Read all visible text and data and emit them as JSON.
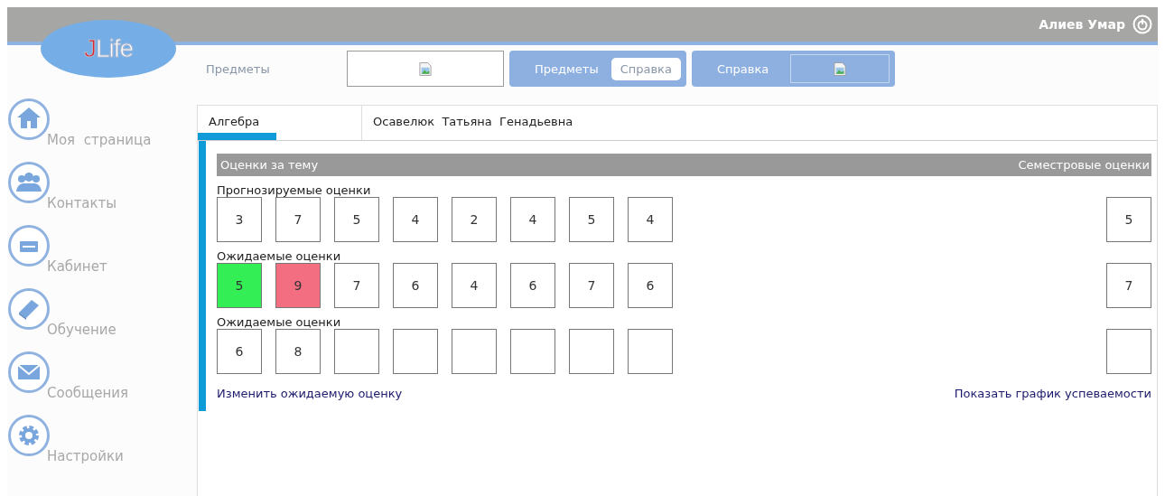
{
  "header": {
    "logo": "JLife",
    "user": "Алиев Умар"
  },
  "nav": [
    {
      "kind": "link",
      "label": "Предметы"
    },
    {
      "kind": "image-box"
    },
    {
      "kind": "group",
      "label": "Предметы",
      "button": "Справка"
    },
    {
      "kind": "group-image",
      "label": "Справка"
    }
  ],
  "sidebar": {
    "items": [
      {
        "label": "Моя  страница"
      },
      {
        "label": "Контакты"
      },
      {
        "label": "Кабинет"
      },
      {
        "label": "Обучение"
      },
      {
        "label": "Сообщения"
      },
      {
        "label": "Настройки"
      }
    ]
  },
  "subject": {
    "tabs": [
      {
        "label": "Алгебра",
        "selected": true
      },
      {
        "label": "Осавелюк  Татьяна  Генадьевна",
        "selected": false
      }
    ],
    "bar": {
      "left": "Оценки за тему",
      "right": "Семестровые оценки"
    },
    "rows": [
      {
        "label": "Прогнозируемые оценки",
        "cells": [
          {
            "value": "3"
          },
          {
            "value": "7"
          },
          {
            "value": "5"
          },
          {
            "value": "4"
          },
          {
            "value": "2"
          },
          {
            "value": "4"
          },
          {
            "value": "5"
          },
          {
            "value": "4"
          }
        ],
        "semester": "5"
      },
      {
        "label": "Ожидаемые оценки",
        "cells": [
          {
            "value": "5",
            "color": "#33ee55"
          },
          {
            "value": "9",
            "color": "#f46e82"
          },
          {
            "value": "7"
          },
          {
            "value": "6"
          },
          {
            "value": "4"
          },
          {
            "value": "6"
          },
          {
            "value": "7"
          },
          {
            "value": "6"
          }
        ],
        "semester": "7"
      },
      {
        "label": "Ожидаемые оценки",
        "cells": [
          {
            "value": "6"
          },
          {
            "value": "8"
          },
          {},
          {},
          {},
          {},
          {},
          {}
        ]
      }
    ],
    "links": {
      "left": "Изменить ожидаемую оценку",
      "right": "Показать график успеваемости"
    }
  }
}
